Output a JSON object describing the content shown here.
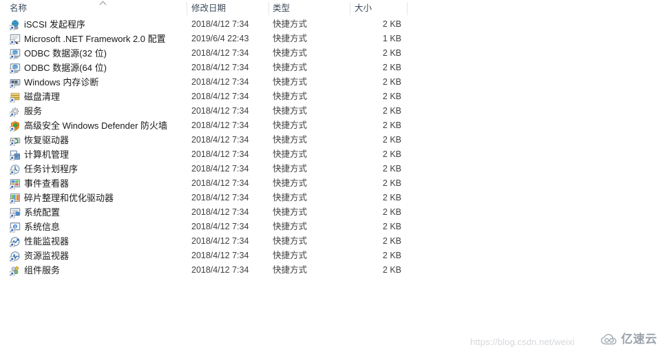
{
  "window": {
    "view": "details",
    "sort_column": "名称",
    "sort_direction": "ascending"
  },
  "columns": [
    {
      "key": "name",
      "label": "名称",
      "sorted": true
    },
    {
      "key": "date",
      "label": "修改日期",
      "sorted": false
    },
    {
      "key": "type",
      "label": "类型",
      "sorted": false
    },
    {
      "key": "size",
      "label": "大小",
      "sorted": false
    }
  ],
  "rows": [
    {
      "icon": "iscsi-initiator-icon",
      "name": "iSCSI 发起程序",
      "date": "2018/4/12 7:34",
      "type": "快捷方式",
      "size": "2 KB"
    },
    {
      "icon": "dotnet-framework-icon",
      "name": "Microsoft .NET Framework 2.0 配置",
      "date": "2019/6/4 22:43",
      "type": "快捷方式",
      "size": "1 KB"
    },
    {
      "icon": "odbc-32-icon",
      "name": "ODBC 数据源(32 位)",
      "date": "2018/4/12 7:34",
      "type": "快捷方式",
      "size": "2 KB"
    },
    {
      "icon": "odbc-64-icon",
      "name": "ODBC 数据源(64 位)",
      "date": "2018/4/12 7:34",
      "type": "快捷方式",
      "size": "2 KB"
    },
    {
      "icon": "memory-diagnostic-icon",
      "name": "Windows 内存诊断",
      "date": "2018/4/12 7:34",
      "type": "快捷方式",
      "size": "2 KB"
    },
    {
      "icon": "disk-cleanup-icon",
      "name": "磁盘清理",
      "date": "2018/4/12 7:34",
      "type": "快捷方式",
      "size": "2 KB"
    },
    {
      "icon": "services-icon",
      "name": "服务",
      "date": "2018/4/12 7:34",
      "type": "快捷方式",
      "size": "2 KB"
    },
    {
      "icon": "firewall-advanced-icon",
      "name": "高级安全 Windows Defender 防火墙",
      "date": "2018/4/12 7:34",
      "type": "快捷方式",
      "size": "2 KB"
    },
    {
      "icon": "recovery-drive-icon",
      "name": "恢复驱动器",
      "date": "2018/4/12 7:34",
      "type": "快捷方式",
      "size": "2 KB"
    },
    {
      "icon": "computer-management-icon",
      "name": "计算机管理",
      "date": "2018/4/12 7:34",
      "type": "快捷方式",
      "size": "2 KB"
    },
    {
      "icon": "task-scheduler-icon",
      "name": "任务计划程序",
      "date": "2018/4/12 7:34",
      "type": "快捷方式",
      "size": "2 KB"
    },
    {
      "icon": "event-viewer-icon",
      "name": "事件查看器",
      "date": "2018/4/12 7:34",
      "type": "快捷方式",
      "size": "2 KB"
    },
    {
      "icon": "defragment-icon",
      "name": "碎片整理和优化驱动器",
      "date": "2018/4/12 7:34",
      "type": "快捷方式",
      "size": "2 KB"
    },
    {
      "icon": "system-configuration-icon",
      "name": "系统配置",
      "date": "2018/4/12 7:34",
      "type": "快捷方式",
      "size": "2 KB"
    },
    {
      "icon": "system-information-icon",
      "name": "系统信息",
      "date": "2018/4/12 7:34",
      "type": "快捷方式",
      "size": "2 KB"
    },
    {
      "icon": "performance-monitor-icon",
      "name": "性能监视器",
      "date": "2018/4/12 7:34",
      "type": "快捷方式",
      "size": "2 KB"
    },
    {
      "icon": "resource-monitor-icon",
      "name": "资源监视器",
      "date": "2018/4/12 7:34",
      "type": "快捷方式",
      "size": "2 KB"
    },
    {
      "icon": "component-services-icon",
      "name": "组件服务",
      "date": "2018/4/12 7:34",
      "type": "快捷方式",
      "size": "2 KB"
    }
  ],
  "watermarks": {
    "url": "https://blog.csdn.net/weixi",
    "brand": "亿速云",
    "brand_logo": "cloud-logo-icon"
  },
  "colors": {
    "header_text": "#3b4a5a",
    "row_text": "#1a1a1a",
    "meta_text": "#404040",
    "separator": "#e2e5e8",
    "watermark_url": "#d4d7db",
    "watermark_brand": "#9aa3ad",
    "background": "#ffffff"
  }
}
